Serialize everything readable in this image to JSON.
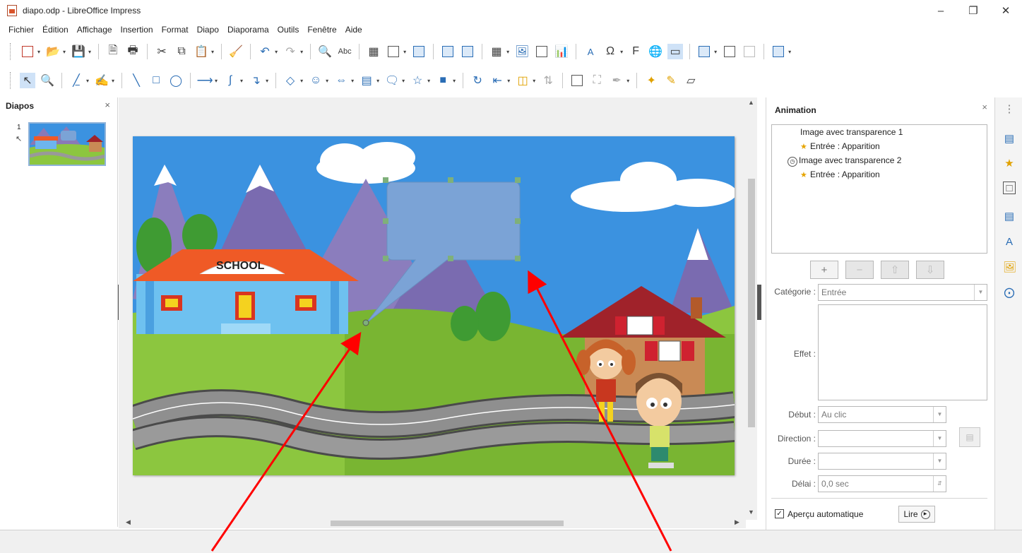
{
  "window": {
    "title": "diapo.odp - LibreOffice Impress",
    "minimize_icon": "minimize-icon",
    "restore_icon": "restore-icon",
    "close_icon": "close-icon"
  },
  "menu": [
    "Fichier",
    "Édition",
    "Affichage",
    "Insertion",
    "Format",
    "Diapo",
    "Diaporama",
    "Outils",
    "Fenêtre",
    "Aide"
  ],
  "slides_pane": {
    "title": "Diapos",
    "close": "×",
    "slide_number": "1"
  },
  "slide": {
    "school_sign": "SCHOOL"
  },
  "animation_pane": {
    "title": "Animation",
    "close": "×",
    "items": [
      {
        "name": "Image avec transparence 1",
        "effect": "Entrée : Apparition"
      },
      {
        "name": "Image avec transparence 2",
        "effect": "Entrée : Apparition"
      }
    ],
    "add_button": "+",
    "category_label": "Catégorie :",
    "category_value": "Entrée",
    "effect_label": "Effet :",
    "start_label": "Début :",
    "start_value": "Au clic",
    "direction_label": "Direction :",
    "direction_value": "",
    "duration_label": "Durée :",
    "duration_value": "",
    "delay_label": "Délai :",
    "delay_value": "0,0 sec",
    "auto_preview_label": "Aperçu automatique",
    "auto_preview_checked": true,
    "play_label": "Lire"
  },
  "colors": {
    "accent": "#2a6db5",
    "annotation_arrow": "#ff0000",
    "sky": "#3b92e0",
    "grass": "#8cc63f",
    "speech_bubble": "#7ba3d6"
  }
}
